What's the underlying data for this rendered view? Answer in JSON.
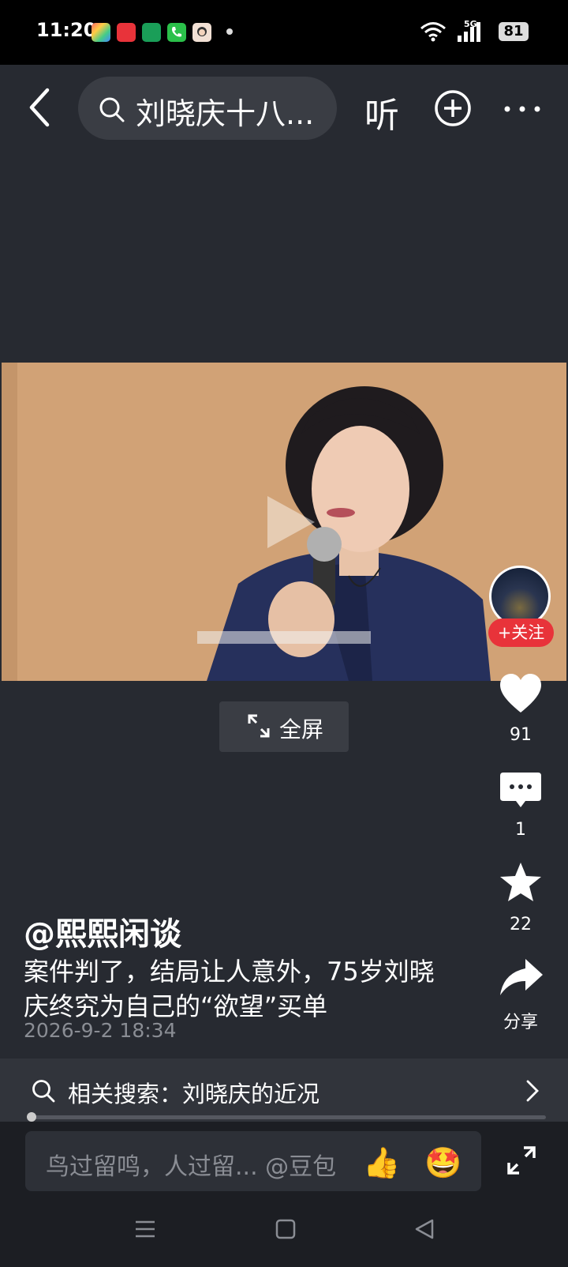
{
  "status_bar": {
    "time": "11:20",
    "network": "5G",
    "battery": "81",
    "app_icons": [
      "app-icon-1",
      "toutiao-icon",
      "app-icon-3",
      "phone-icon",
      "app-icon-5"
    ]
  },
  "top_bar": {
    "search_text": "刘晓庆十八...",
    "listen_label": "听"
  },
  "video": {
    "fullscreen_label": "全屏"
  },
  "rail": {
    "follow_label": "+关注",
    "likes": "91",
    "comments": "1",
    "favorites": "22",
    "share_label": "分享"
  },
  "post": {
    "author": "@熙熙闲谈",
    "caption": "案件判了，结局让人意外，75岁刘晓庆终究为自己的“欲望”买单",
    "date": "2026-9-2 18:34"
  },
  "related": {
    "label": "相关搜索：刘晓庆的近况"
  },
  "comment_bar": {
    "placeholder": "鸟过留鸣，人过留... @豆包",
    "emoji_1": "👍",
    "emoji_2": "🤩"
  },
  "colors": {
    "background": "#272a31",
    "follow_red": "#e8333a",
    "video_bg": "#d4a57c"
  }
}
